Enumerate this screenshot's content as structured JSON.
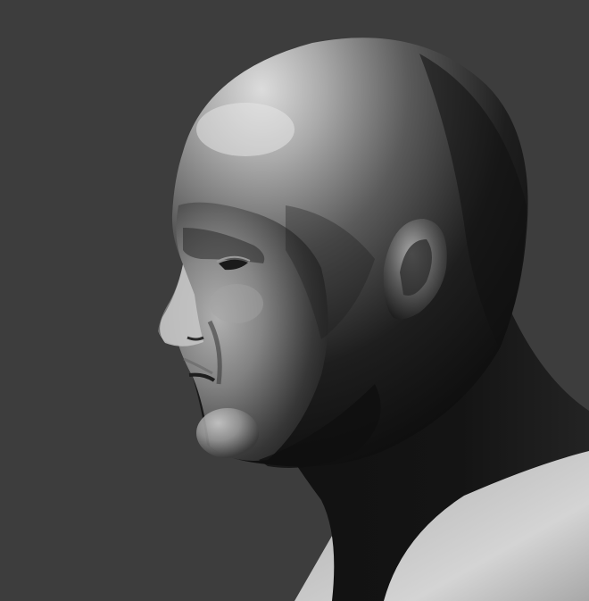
{
  "scene": {
    "subject": "sculpted-head-render",
    "colors": {
      "background": "#3d3d3d",
      "skin_light": "#d9d9d9",
      "skin_mid": "#8a8a8a",
      "skin_dark": "#1b1b1b",
      "shadow": "#0a0a0a"
    }
  }
}
